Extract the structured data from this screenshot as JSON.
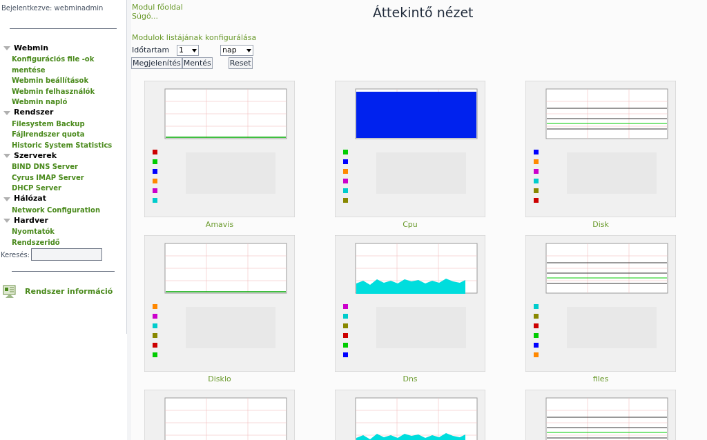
{
  "sidebar": {
    "logged_in": "Bejelentkezve: webminadmin",
    "sections": [
      {
        "label": "Webmin",
        "expanded": true,
        "children": [
          {
            "label": "Konfigurációs file -ok mentése"
          },
          {
            "label": "Webmin beállítások"
          },
          {
            "label": "Webmin felhasználók"
          },
          {
            "label": "Webmin napló"
          }
        ]
      },
      {
        "label": "Rendszer",
        "expanded": true,
        "children": [
          {
            "label": "Filesystem Backup"
          },
          {
            "label": "Fájlrendszer quota"
          },
          {
            "label": "Historic System Statistics"
          }
        ]
      },
      {
        "label": "Szerverek",
        "expanded": true,
        "children": [
          {
            "label": "BIND DNS Server"
          },
          {
            "label": "Cyrus IMAP Server"
          },
          {
            "label": "DHCP Server"
          }
        ]
      },
      {
        "label": "Hálózat",
        "expanded": true,
        "children": [
          {
            "label": "Network Configuration"
          }
        ]
      },
      {
        "label": "Hardver",
        "expanded": true,
        "children": [
          {
            "label": "Nyomtatók"
          },
          {
            "label": "Rendszeridő"
          }
        ]
      }
    ],
    "search_label": "Keresés:",
    "system_info": "Rendszer információ"
  },
  "main": {
    "links": [
      "Modul főoldal",
      "Súgó..."
    ],
    "title": "Áttekintő nézet",
    "config_link": "Modulok listájának konfigurálása",
    "period_label": "Időtartam",
    "period_value": "1",
    "unit_value": "nap",
    "buttons": [
      "Megjelenítés",
      "Mentés"
    ],
    "reset_button": "Reset",
    "graphs": [
      {
        "kind": "picture",
        "caption": "Amavis"
      },
      {
        "kind": "picture",
        "caption": "Cpu"
      },
      {
        "kind": "picture",
        "caption": "Disk"
      },
      {
        "kind": "picture",
        "caption": "Disklo"
      },
      {
        "kind": "picture",
        "caption": "Dns"
      },
      {
        "kind": "picture",
        "caption": "files"
      },
      {
        "kind": "picture"
      },
      {
        "kind": "picture"
      },
      {
        "kind": "picture"
      }
    ]
  }
}
